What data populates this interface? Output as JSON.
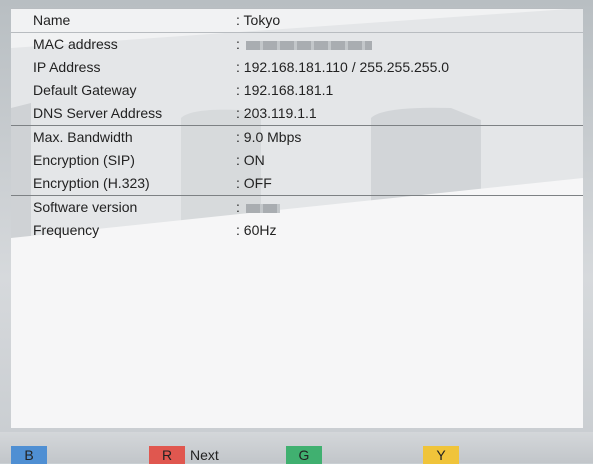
{
  "rows": [
    {
      "label": "Name",
      "value": ": Tokyo"
    },
    {
      "label": "MAC address",
      "value": ":"
    },
    {
      "label": "IP Address",
      "value": ": 192.168.181.110 / 255.255.255.0"
    },
    {
      "label": "Default Gateway",
      "value": ": 192.168.181.1"
    },
    {
      "label": "DNS Server Address",
      "value": ": 203.119.1.1"
    },
    {
      "label": "Max. Bandwidth",
      "value": ": 9.0 Mbps"
    },
    {
      "label": "Encryption (SIP)",
      "value": ": ON"
    },
    {
      "label": "Encryption (H.323)",
      "value": ": OFF"
    },
    {
      "label": "Software version",
      "value": ":"
    },
    {
      "label": "Frequency",
      "value": ": 60Hz"
    }
  ],
  "footer": {
    "blue_key": "B",
    "red_key": "R",
    "red_label": "Next",
    "green_key": "G",
    "yellow_key": "Y"
  },
  "colors": {
    "blue": "#4f8fd3",
    "red": "#e0574f",
    "green": "#40b070",
    "yellow": "#f0c43a"
  }
}
